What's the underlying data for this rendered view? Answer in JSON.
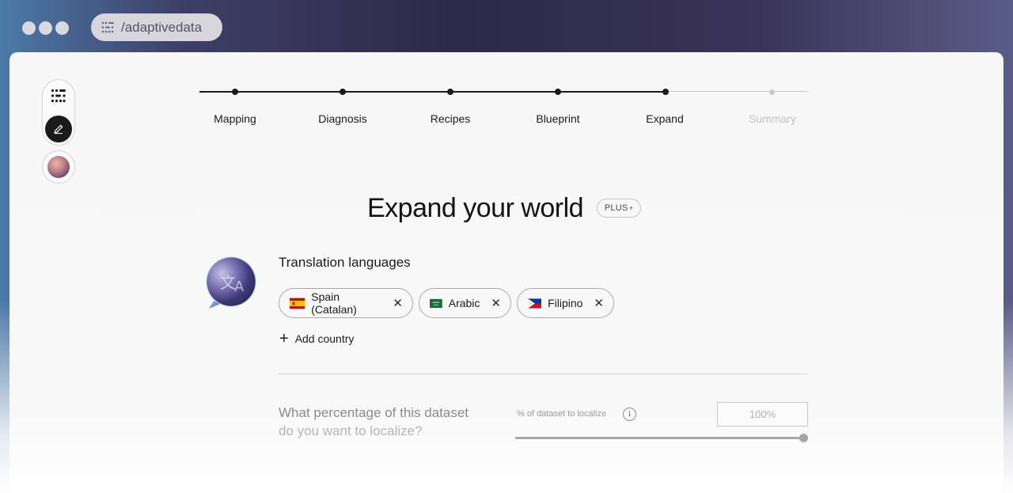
{
  "browser": {
    "url": "/adaptivedata"
  },
  "sidebar": {
    "items": [
      {
        "icon": "dataset-dots-icon"
      },
      {
        "icon": "pencil-icon",
        "active": true
      },
      {
        "icon": "avatar"
      }
    ]
  },
  "steps": [
    {
      "label": "Mapping",
      "state": "done"
    },
    {
      "label": "Diagnosis",
      "state": "done"
    },
    {
      "label": "Recipes",
      "state": "done"
    },
    {
      "label": "Blueprint",
      "state": "done"
    },
    {
      "label": "Expand",
      "state": "current"
    },
    {
      "label": "Summary",
      "state": "upcoming"
    }
  ],
  "main": {
    "title": "Expand your world",
    "badge": "PLUS",
    "badge_mark": "+",
    "languages_label": "Translation languages",
    "languages": [
      {
        "label": "Spain (Catalan)",
        "flag": "spain"
      },
      {
        "label": "Arabic",
        "flag": "saudi-arabia"
      },
      {
        "label": "Filipino",
        "flag": "philippines"
      }
    ],
    "add_country_label": "Add country",
    "question_line1": "What percentage of this dataset",
    "question_line2": "do you want to localize?",
    "slider_label": "% of dataset to localize",
    "info_glyph": "i",
    "percent_value": "100%",
    "slider_level": 1.0
  },
  "colors": {
    "accent": "#1b1b1b",
    "muted": "#c9c9cc"
  }
}
